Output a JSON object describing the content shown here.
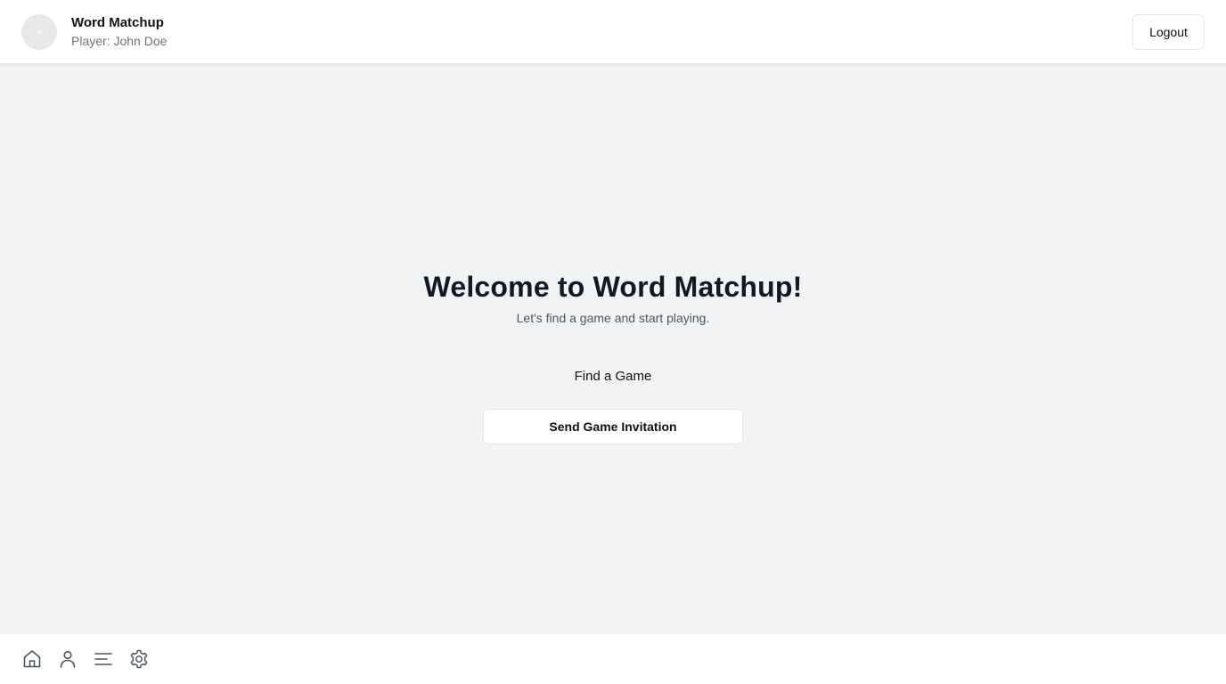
{
  "header": {
    "app_title": "Word Matchup",
    "player_label": "Player: John Doe",
    "logout_label": "Logout"
  },
  "main": {
    "title": "Welcome to Word Matchup!",
    "subtitle": "Let's find a game and start playing.",
    "find_game_label": "Find a Game",
    "send_invitation_label": "Send Game Invitation"
  },
  "bottom_nav": {
    "icons": [
      "home-icon",
      "user-icon",
      "menu-icon",
      "gear-icon"
    ]
  },
  "colors": {
    "background": "#f2f3f5",
    "surface": "#ffffff",
    "border": "#e5e7eb",
    "muted_text": "#6b7280",
    "title_text": "#111827"
  }
}
